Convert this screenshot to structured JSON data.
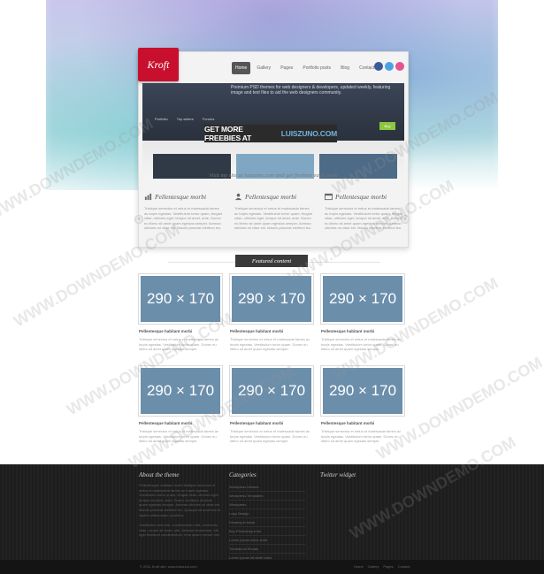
{
  "brand": {
    "logo_text": "Kroft"
  },
  "nav": {
    "items": [
      "Home",
      "Gallery",
      "Pages",
      "Portfolio posts",
      "Blog",
      "Contact"
    ],
    "active": "Home"
  },
  "social": {
    "colors": [
      "#3b5998",
      "#4aa3df",
      "#e2558f"
    ],
    "icons": [
      "facebook-icon",
      "twitter-icon",
      "dribbble-icon"
    ]
  },
  "slider": {
    "copy": "Premium PSD themes for web designers & developers, updated weekly, featuring image and text files to aid the web designers community.",
    "tabs": [
      "Portfolio",
      "Top sellers",
      "Forums"
    ],
    "button_label": "Buy",
    "thumb_colors": [
      "#2f3a46",
      "#7fa7c4",
      "#4d6a86"
    ],
    "banner_text": "GET MORE FREEBIES AT",
    "banner_highlight": "LUISZUNO.COM"
  },
  "visit_text": "Visit my site at luiszuno.com and get freebies each week",
  "features": [
    {
      "icon": "chart-icon",
      "title": "Pellentesque morbi",
      "text": "Tristique senectus et netus et malesuada fames ac turpis egestas. Vestibulum tortor quam, feugiat vitae, ultricies eget, tempor sit amet, ante. Donec eu libero sit amet quam egestas semper. Aenean ultricies mi vitae est. Mauris placerat eleifend leo."
    },
    {
      "icon": "person-icon",
      "title": "Pellentesque morbi",
      "text": "Tristique senectus et netus et malesuada fames ac turpis egestas. Vestibulum tortor quam, feugiat vitae, ultricies eget, tempor sit amet, ante. Donec eu libero sit amet quam egestas semper. Aenean ultricies mi vitae est. Mauris placerat eleifend leo."
    },
    {
      "icon": "window-icon",
      "title": "Pellentesque morbi",
      "text": "Tristique senectus et netus et malesuada fames ac turpis egestas. Vestibulum tortor quam, feugiat vitae, ultricies eget, tempor sit amet, ante. Donec eu libero sit amet quam egestas semper. Aenean ultricies mi vitae est. Mauris placerat eleifend leo."
    }
  ],
  "featured_label": "Featured content",
  "cards": [
    {
      "image_label": "290 × 170",
      "title": "Pellentesque habitant morbi",
      "text": "Tristique senectus et netus et malesuada fames ac turpis egestas. Vestibulum tortor quam. Donec eu libero sit amet quam egestas semper."
    },
    {
      "image_label": "290 × 170",
      "title": "Pellentesque habitant morbi",
      "text": "Tristique senectus et netus et malesuada fames ac turpis egestas. Vestibulum tortor quam. Donec eu libero sit amet quam egestas semper."
    },
    {
      "image_label": "290 × 170",
      "title": "Pellentesque habitant morbi",
      "text": "Tristique senectus et netus et malesuada fames ac turpis egestas. Vestibulum tortor quam. Donec eu libero sit amet quam egestas semper."
    },
    {
      "image_label": "290 × 170",
      "title": "Pellentesque habitant morbi",
      "text": "Tristique senectus et netus et malesuada fames ac turpis egestas. Vestibulum tortor quam. Donec eu libero sit amet quam egestas semper."
    },
    {
      "image_label": "290 × 170",
      "title": "Pellentesque habitant morbi",
      "text": "Tristique senectus et netus et malesuada fames ac turpis egestas. Vestibulum tortor quam. Donec eu libero sit amet quam egestas semper."
    },
    {
      "image_label": "290 × 170",
      "title": "Pellentesque habitant morbi",
      "text": "Tristique senectus et netus et malesuada fames ac turpis egestas. Vestibulum tortor quam. Donec eu libero sit amet quam egestas semper."
    }
  ],
  "footer": {
    "about_title": "About the theme",
    "about_text": "Pellentesque habitant morbi tristique senectus et netus et malesuada fames ac turpis egestas. Vestibulum tortor quam, feugiat vitae, ultricies eget, tempor sit amet, ante. Donec eu libero sit amet quam egestas semper. Aenean ultricies mi vitae est. Mauris placerat eleifend leo. Quisque sit amet est et sapien ullamcorper pharetra.",
    "about_text_2": "Vestibulum erat wisi, condimentum sed, commodo vitae, ornare sit amet, wisi. Aenean fermentum, elit eget tincidunt condimentum, eros ipsum rutrum orci.",
    "categories_title": "Categories",
    "categories": [
      "Wordpress themes",
      "Wordpress Templates",
      "Wordpress",
      "Logo Design",
      "Drawing in head",
      "Buy Photoshop tutor",
      "Lorem ipsum dolor amet",
      "Tutorials at Envato",
      "Lorem ipsum sit amet dolor"
    ],
    "twitter_title": "Twitter widget"
  },
  "bottom": {
    "copyright": "© 2011 Kroft site. www.luiszuno.com",
    "links": [
      "Home",
      "Gallery",
      "Pages",
      "Contact"
    ]
  },
  "watermark": "WWW.DOWNDEMO.COM"
}
